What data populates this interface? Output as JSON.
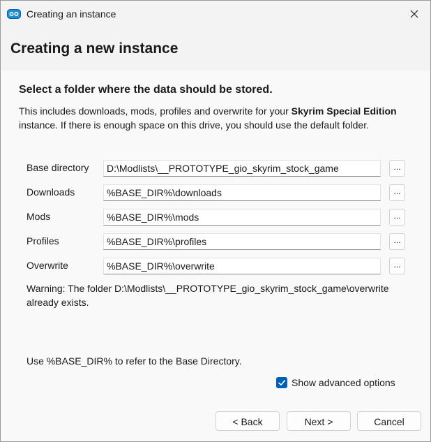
{
  "window": {
    "title": "Creating an instance"
  },
  "header": {
    "title": "Creating a new instance"
  },
  "section": {
    "heading": "Select a folder where the data should be stored.",
    "description_before": "This includes downloads, mods, profiles and overwrite for your ",
    "description_game": "Skyrim Special Edition",
    "description_after": " instance. If there is enough space on this drive, you should use the default folder."
  },
  "paths": [
    {
      "label": "Base directory",
      "value": "D:\\Modlists\\__PROTOTYPE_gio_skyrim_stock_game",
      "browse_label": "..."
    },
    {
      "label": "Downloads",
      "value": "%BASE_DIR%\\downloads",
      "browse_label": "..."
    },
    {
      "label": "Mods",
      "value": "%BASE_DIR%\\mods",
      "browse_label": "..."
    },
    {
      "label": "Profiles",
      "value": "%BASE_DIR%\\profiles",
      "browse_label": "..."
    },
    {
      "label": "Overwrite",
      "value": "%BASE_DIR%\\overwrite",
      "browse_label": "..."
    }
  ],
  "warning": "Warning: The folder D:\\Modlists\\__PROTOTYPE_gio_skyrim_stock_game\\overwrite already exists.",
  "hint": "Use %BASE_DIR% to refer to the Base Directory.",
  "advanced": {
    "label": "Show advanced options",
    "checked": true
  },
  "buttons": {
    "back": "< Back",
    "next": "Next >",
    "cancel": "Cancel"
  },
  "icons": {
    "app": "mo2-app-icon",
    "close": "close-icon",
    "check": "checkmark-icon"
  },
  "colors": {
    "accent": "#005fb8"
  }
}
